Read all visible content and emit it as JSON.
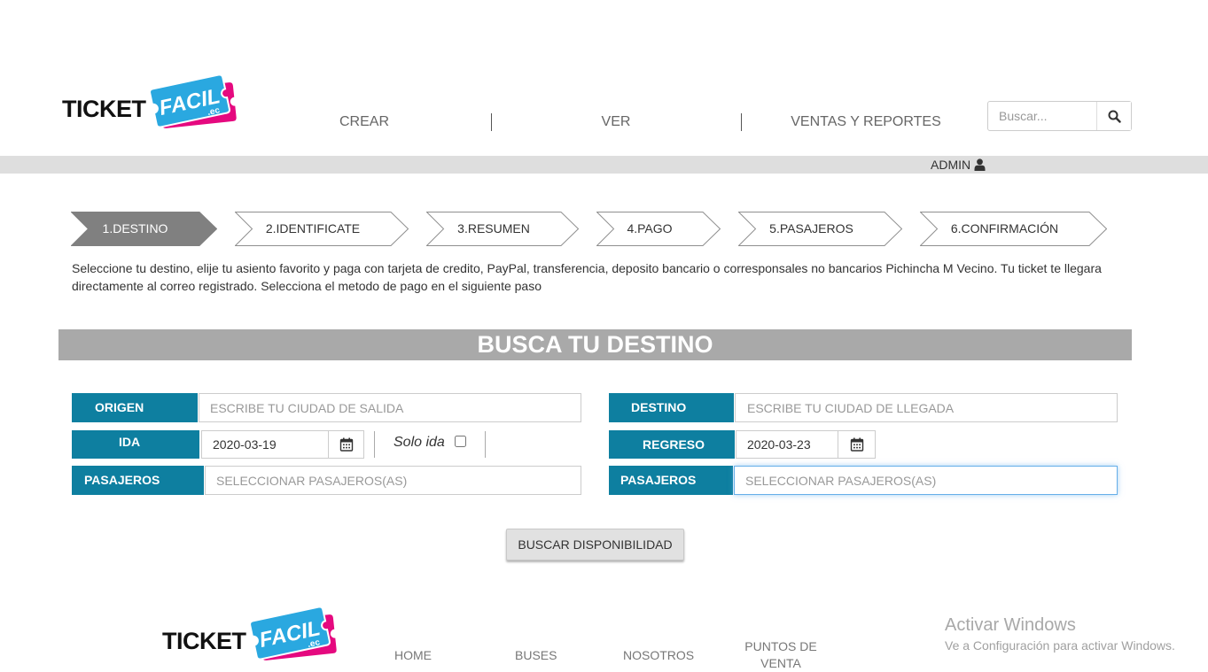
{
  "brand": {
    "word": "TICKET",
    "tag": "FACIL",
    "suffix": ".ec"
  },
  "nav": {
    "items": [
      "CREAR",
      "VER",
      "VENTAS Y REPORTES"
    ]
  },
  "search": {
    "placeholder": "Buscar...",
    "icon": "search-icon"
  },
  "user_bar": {
    "username": "ADMIN",
    "icon": "user-icon"
  },
  "steps": [
    {
      "label": "1.DESTINO",
      "active": true
    },
    {
      "label": "2.IDENTIFICATE",
      "active": false
    },
    {
      "label": "3.RESUMEN",
      "active": false
    },
    {
      "label": "4.PAGO",
      "active": false
    },
    {
      "label": "5.PASAJEROS",
      "active": false
    },
    {
      "label": "6.CONFIRMACIÓN",
      "active": false
    }
  ],
  "intro_text": "Seleccione tu destino, elije tu asiento favorito y paga con tarjeta de credito, PayPal, transferencia, deposito bancario o corresponsales no bancarios Pichincha M Vecino. Tu ticket te llegara directamente al correo registrado. Selecciona el metodo de pago en el siguiente paso",
  "section_title": "BUSCA TU DESTINO",
  "form": {
    "origin": {
      "label": "ORIGEN",
      "placeholder": "ESCRIBE TU CIUDAD DE SALIDA"
    },
    "destination": {
      "label": "DESTINO",
      "placeholder": "ESCRIBE TU CIUDAD DE LLEGADA"
    },
    "departure": {
      "label": "IDA",
      "value": "2020-03-19",
      "icon": "calendar-icon"
    },
    "one_way": {
      "label": "Solo ida",
      "checked": false
    },
    "return": {
      "label": "REGRESO",
      "value": "2020-03-23",
      "icon": "calendar-icon"
    },
    "passengers_out": {
      "label": "PASAJEROS",
      "placeholder": "SELECCIONAR PASAJEROS(AS)"
    },
    "passengers_return": {
      "label": "PASAJEROS",
      "placeholder": "SELECCIONAR PASAJEROS(AS)",
      "focused": true
    }
  },
  "submit_label": "BUSCAR DISPONIBILIDAD",
  "footer": {
    "links": [
      "HOME",
      "BUSES",
      "NOSOTROS",
      "PUNTOS DE VENTA"
    ]
  },
  "os_watermark": {
    "title": "Activar Windows",
    "subtitle": "Ve a Configuración para activar Windows."
  },
  "colors": {
    "label_bg": "#0e7fa0",
    "step_active": "#808080",
    "section_header": "#a9a9a9",
    "logo_blue": "#2aa8e0",
    "logo_pink": "#e5097f"
  }
}
